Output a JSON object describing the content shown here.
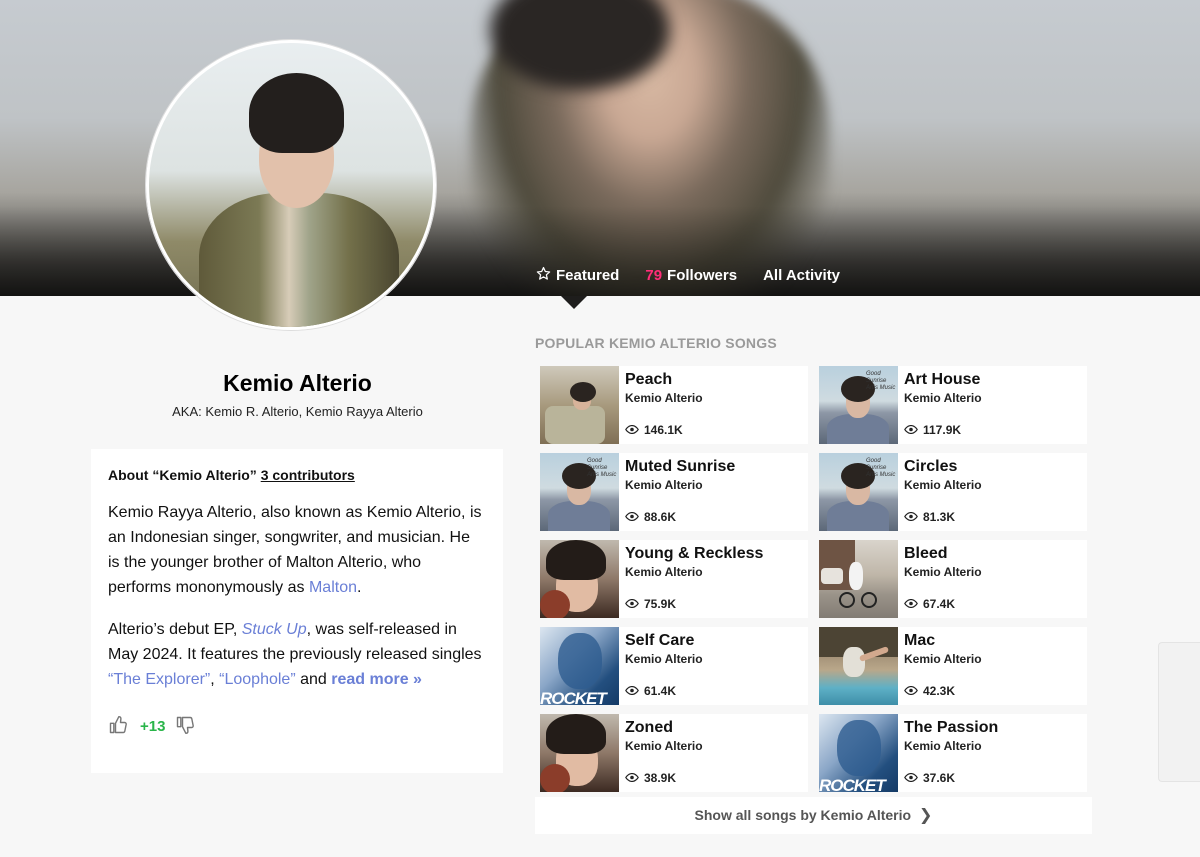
{
  "nav": {
    "featured_label": "Featured",
    "followers_count": "79",
    "followers_label": "Followers",
    "activity_label": "All Activity"
  },
  "artist": {
    "name": "Kemio Alterio",
    "aka": "AKA: Kemio R. Alterio, Kemio Rayya Alterio"
  },
  "about": {
    "heading_prefix": "About “Kemio Alterio”",
    "contributors": "3 contributors",
    "p1_text": "Kemio Rayya Alterio, also known as Kemio Alterio, is an Indonesian singer, songwriter, and musician. He is the younger brother of Malton Alterio, who performs mononymously as ",
    "p1_link": "Malton",
    "p1_end": ".",
    "p2_start": "Alterio’s debut EP, ",
    "p2_ep": "Stuck Up",
    "p2_mid": ", was self-released in May 2024. It features the previously released singles ",
    "p2_single1": "“The Explorer”",
    "p2_comma": ", ",
    "p2_single2": "“Loophole”",
    "p2_and": " and ",
    "read_more": "read more »",
    "vote_score": "+13"
  },
  "songs_section": {
    "title": "POPULAR KEMIO ALTERIO SONGS",
    "show_all": "Show all songs by Kemio Alterio",
    "items": [
      {
        "title": "Peach",
        "artist": "Kemio Alterio",
        "views": "146.1K",
        "art": "room"
      },
      {
        "title": "Art House",
        "artist": "Kemio Alterio",
        "views": "117.9K",
        "art": "sky"
      },
      {
        "title": "Muted Sunrise",
        "artist": "Kemio Alterio",
        "views": "88.6K",
        "art": "sky"
      },
      {
        "title": "Circles",
        "artist": "Kemio Alterio",
        "views": "81.3K",
        "art": "sky"
      },
      {
        "title": "Young & Reckless",
        "artist": "Kemio Alterio",
        "views": "75.9K",
        "art": "close"
      },
      {
        "title": "Bleed",
        "artist": "Kemio Alterio",
        "views": "67.4K",
        "art": "street"
      },
      {
        "title": "Self Care",
        "artist": "Kemio Alterio",
        "views": "61.4K",
        "art": "blue"
      },
      {
        "title": "Mac",
        "artist": "Kemio Alterio",
        "views": "42.3K",
        "art": "mac"
      },
      {
        "title": "Zoned",
        "artist": "Kemio Alterio",
        "views": "38.9K",
        "art": "close"
      },
      {
        "title": "The Passion",
        "artist": "Kemio Alterio",
        "views": "37.6K",
        "art": "blue"
      }
    ],
    "cover_text": {
      "sky_scrawl": "Good Sunrise\nArtis Music",
      "rocket": "ROCKET"
    }
  },
  "colors": {
    "accent_pink": "#ff2d78",
    "link_blue": "#6a7fd6",
    "vote_green": "#2ab54a"
  }
}
